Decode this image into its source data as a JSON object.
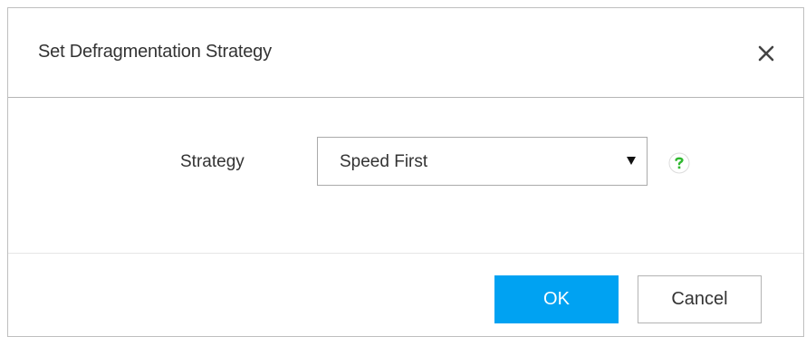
{
  "dialog": {
    "title": "Set Defragmentation Strategy",
    "close_icon": "close-icon"
  },
  "form": {
    "strategy_label": "Strategy",
    "strategy_value": "Speed First",
    "dropdown_icon": "caret-down-icon",
    "help_icon": "question-help-icon"
  },
  "footer": {
    "ok_label": "OK",
    "cancel_label": "Cancel"
  },
  "colors": {
    "primary": "#00a2f2",
    "help_green": "#2fb82f",
    "text": "#333333",
    "border": "#aaaaaa"
  }
}
